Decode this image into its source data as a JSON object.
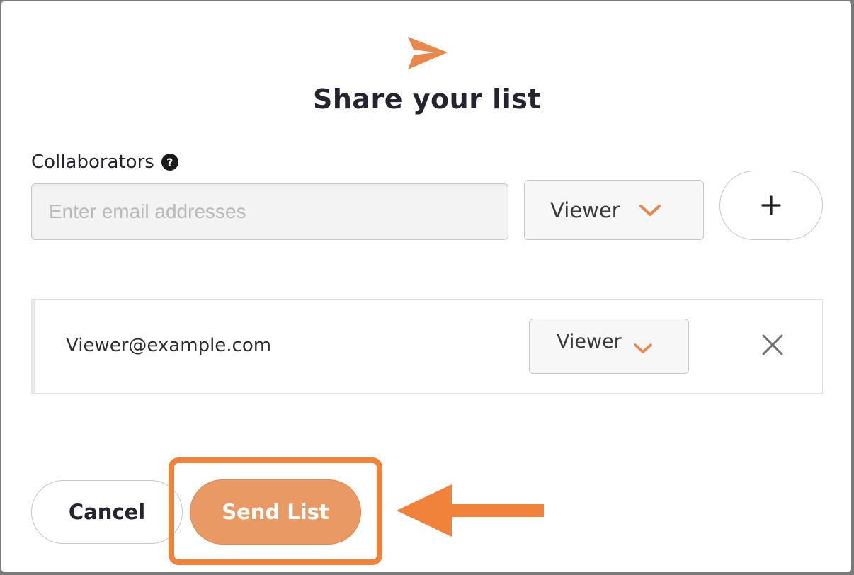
{
  "dialog": {
    "title": "Share your list",
    "icon": "send-icon"
  },
  "collaborators": {
    "label": "Collaborators",
    "help_icon": "question-circle-icon",
    "help_glyph": "?",
    "email_placeholder": "Enter email addresses",
    "email_value": "",
    "role_selected": "Viewer",
    "add_icon": "plus-icon"
  },
  "collaborator_list": [
    {
      "email": "Viewer@example.com",
      "role": "Viewer",
      "remove_icon": "close-icon"
    }
  ],
  "actions": {
    "cancel_label": "Cancel",
    "send_label": "Send List"
  },
  "colors": {
    "accent": "#e9884a",
    "annotation": "#f0823a",
    "send_button_bg": "#e99a64",
    "title_text": "#25232e"
  },
  "annotation": {
    "highlight": "send-button",
    "arrow_icon": "arrow-left-icon"
  }
}
